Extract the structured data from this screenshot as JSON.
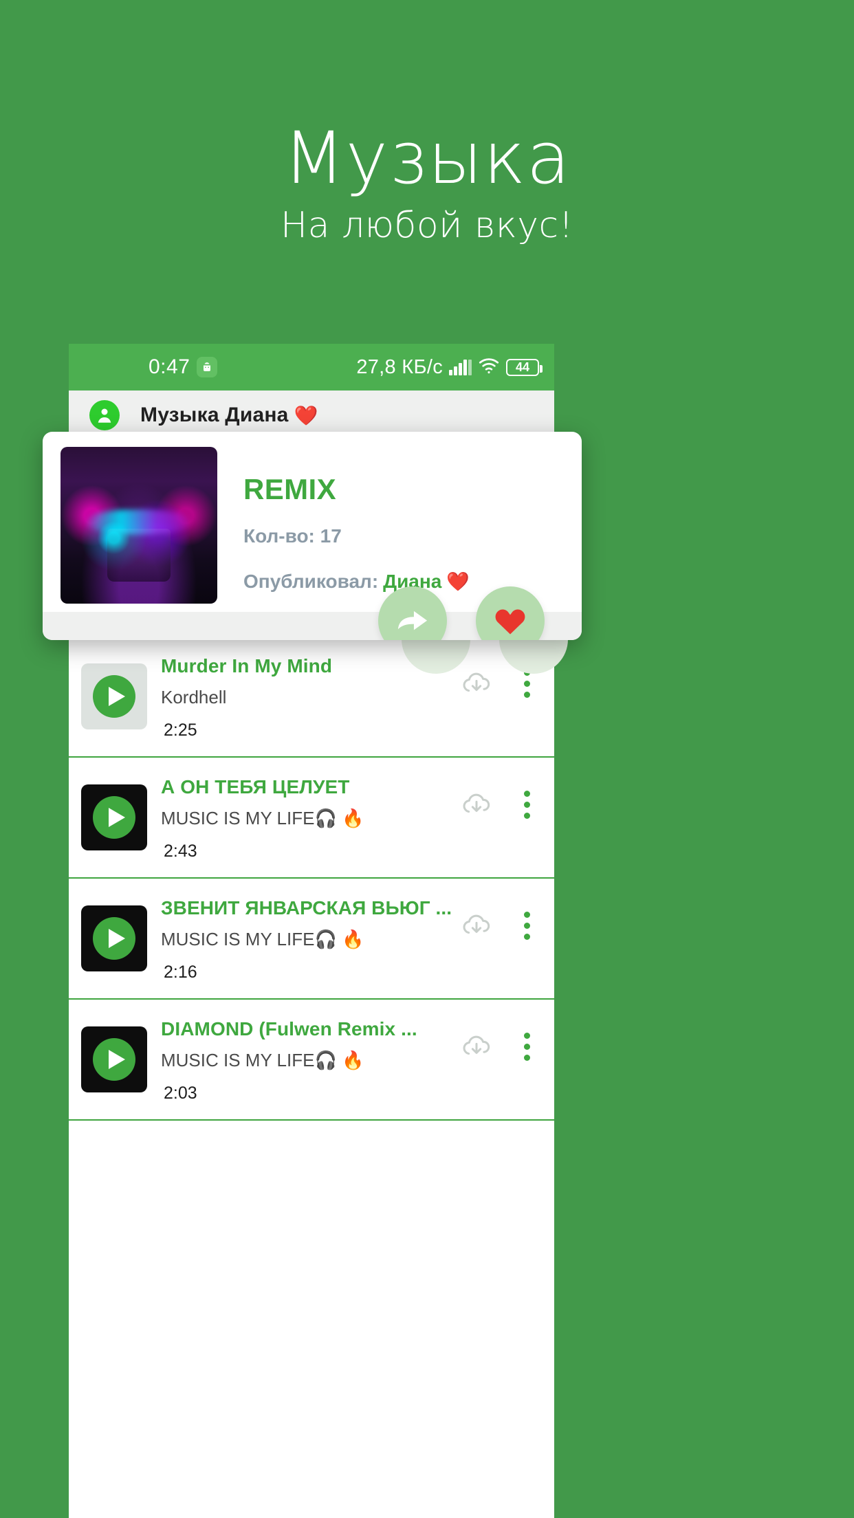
{
  "promo": {
    "title": "Музыка",
    "subtitle": "На любой вкус!"
  },
  "colors": {
    "background": "#42994a",
    "statusbar": "#4caf50",
    "accent_green": "#3fa83f",
    "appbar": "#eff0ef",
    "muted_text": "#8b9aa6",
    "heart_red": "#e8362d"
  },
  "statusbar": {
    "time": "0:47",
    "android_icon": "android-robot-icon",
    "network_speed": "27,8 КБ/с",
    "signal_icon": "signal-bars-icon",
    "wifi_icon": "wifi-icon",
    "battery_level": "44"
  },
  "appbar": {
    "avatar_icon": "account-circle-icon",
    "title": "Музыка Диана",
    "heart": "❤️"
  },
  "playlist_card": {
    "cover_art": "album-art-neon-car",
    "title": "REMIX",
    "count_label": "Кол-во: 17",
    "published_label": "Опубликовал:",
    "published_by": "Диана",
    "published_heart": "❤️",
    "share_button_icon": "share-arrow-icon",
    "like_button_icon": "heart-icon",
    "like_button_glyph": "❤"
  },
  "tracks": [
    {
      "thumb_style": "pale",
      "play_icon": "play-icon",
      "title": "Murder In My Mind",
      "artist": "Kordhell",
      "duration": "2:25",
      "download_icon": "download-cloud-icon",
      "menu_icon": "more-vertical-icon"
    },
    {
      "thumb_style": "dark",
      "play_icon": "play-icon",
      "title": "А ОН ТЕБЯ ЦЕЛУЕТ",
      "artist": "MUSIC IS MY LIFE🎧 🔥",
      "duration": "2:43",
      "download_icon": "download-cloud-icon",
      "menu_icon": "more-vertical-icon"
    },
    {
      "thumb_style": "dark",
      "play_icon": "play-icon",
      "title": "ЗВЕНИТ ЯНВАРСКАЯ ВЬЮГ ...",
      "artist": "MUSIC IS MY LIFE🎧 🔥",
      "duration": "2:16",
      "download_icon": "download-cloud-icon",
      "menu_icon": "more-vertical-icon"
    },
    {
      "thumb_style": "dark",
      "play_icon": "play-icon",
      "title": "DIAMOND (Fulwen Remix ...",
      "artist": "MUSIC IS MY LIFE🎧 🔥",
      "duration": "2:03",
      "download_icon": "download-cloud-icon",
      "menu_icon": "more-vertical-icon"
    }
  ]
}
